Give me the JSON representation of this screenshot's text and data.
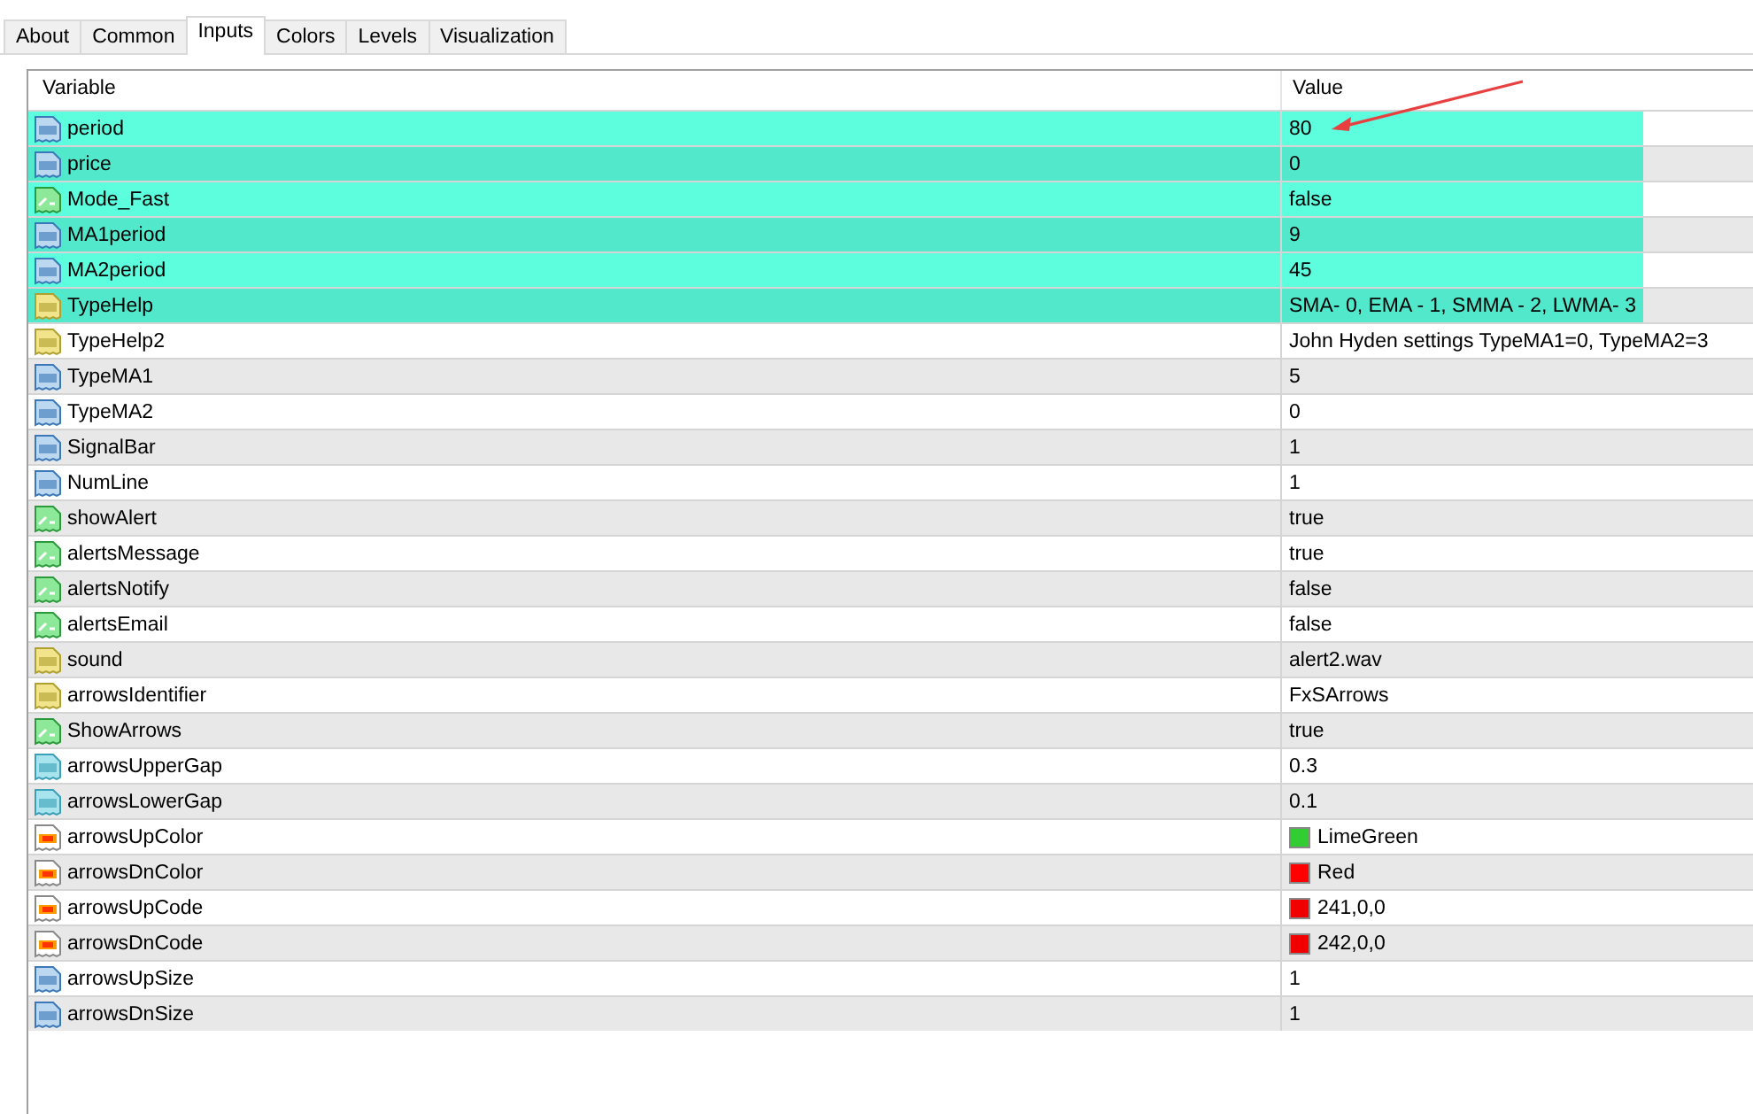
{
  "tabs": [
    {
      "label": "About",
      "selected": false
    },
    {
      "label": "Common",
      "selected": false
    },
    {
      "label": "Inputs",
      "selected": true
    },
    {
      "label": "Colors",
      "selected": false
    },
    {
      "label": "Levels",
      "selected": false
    },
    {
      "label": "Visualization",
      "selected": false
    }
  ],
  "table": {
    "columns": [
      "Variable",
      "Value"
    ],
    "rows": [
      {
        "kind": "int",
        "variable": "period",
        "value": "80",
        "highlighted": true
      },
      {
        "kind": "int",
        "variable": "price",
        "value": "0",
        "highlighted": true
      },
      {
        "kind": "bool",
        "variable": "Mode_Fast",
        "value": "false",
        "highlighted": true
      },
      {
        "kind": "int",
        "variable": "MA1period",
        "value": "9",
        "highlighted": true
      },
      {
        "kind": "int",
        "variable": "MA2period",
        "value": "45",
        "highlighted": true
      },
      {
        "kind": "string",
        "variable": "TypeHelp",
        "value": "SMA- 0, EMA - 1, SMMA - 2, LWMA- 3",
        "highlighted": true
      },
      {
        "kind": "string",
        "variable": "TypeHelp2",
        "value": "John Hyden settings TypeMA1=0, TypeMA2=3",
        "highlighted": false
      },
      {
        "kind": "int",
        "variable": "TypeMA1",
        "value": "5",
        "highlighted": false
      },
      {
        "kind": "int",
        "variable": "TypeMA2",
        "value": "0",
        "highlighted": false
      },
      {
        "kind": "int",
        "variable": "SignalBar",
        "value": "1",
        "highlighted": false
      },
      {
        "kind": "int",
        "variable": "NumLine",
        "value": "1",
        "highlighted": false
      },
      {
        "kind": "bool",
        "variable": "showAlert",
        "value": "true",
        "highlighted": false
      },
      {
        "kind": "bool",
        "variable": "alertsMessage",
        "value": "true",
        "highlighted": false
      },
      {
        "kind": "bool",
        "variable": "alertsNotify",
        "value": "false",
        "highlighted": false
      },
      {
        "kind": "bool",
        "variable": "alertsEmail",
        "value": "false",
        "highlighted": false
      },
      {
        "kind": "string",
        "variable": "sound",
        "value": "alert2.wav",
        "highlighted": false
      },
      {
        "kind": "string",
        "variable": "arrowsIdentifier",
        "value": "FxSArrows",
        "highlighted": false
      },
      {
        "kind": "bool",
        "variable": "ShowArrows",
        "value": "true",
        "highlighted": false
      },
      {
        "kind": "double",
        "variable": "arrowsUpperGap",
        "value": "0.3",
        "highlighted": false
      },
      {
        "kind": "double",
        "variable": "arrowsLowerGap",
        "value": "0.1",
        "highlighted": false
      },
      {
        "kind": "color",
        "variable": "arrowsUpColor",
        "value": "LimeGreen",
        "color": "#32cd32",
        "highlighted": false
      },
      {
        "kind": "color",
        "variable": "arrowsDnColor",
        "value": "Red",
        "color": "#ff0000",
        "highlighted": false
      },
      {
        "kind": "color",
        "variable": "arrowsUpCode",
        "value": "241,0,0",
        "color": "#f10000",
        "highlighted": false
      },
      {
        "kind": "color",
        "variable": "arrowsDnCode",
        "value": "242,0,0",
        "color": "#f20000",
        "highlighted": false
      },
      {
        "kind": "int",
        "variable": "arrowsUpSize",
        "value": "1",
        "highlighted": false
      },
      {
        "kind": "int",
        "variable": "arrowsDnSize",
        "value": "1",
        "highlighted": false
      }
    ]
  }
}
